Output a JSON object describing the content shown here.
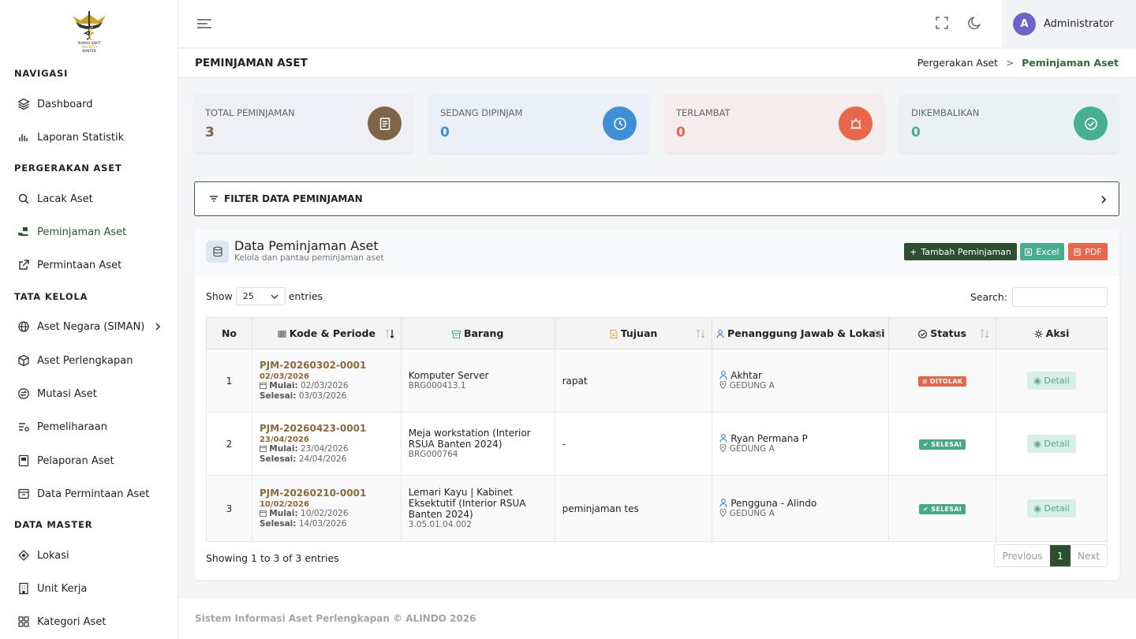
{
  "logo": {
    "text_line1": "RUMAH SAKIT",
    "text_line2": "AKHIRATA",
    "text_line3": "BANTEN"
  },
  "sidebar": {
    "sections": [
      {
        "title": "NAVIGASI",
        "items": [
          {
            "label": "Dashboard",
            "icon": "layers-icon"
          },
          {
            "label": "Laporan Statistik",
            "icon": "bar-chart-icon"
          }
        ]
      },
      {
        "title": "PERGERAKAN ASET",
        "items": [
          {
            "label": "Lacak Aset",
            "icon": "search-icon"
          },
          {
            "label": "Peminjaman Aset",
            "icon": "hand-box-icon",
            "active": true
          },
          {
            "label": "Permintaan Aset",
            "icon": "external-link-icon"
          }
        ]
      },
      {
        "title": "TATA KELOLA",
        "items": [
          {
            "label": "Aset Negara (SIMAN)",
            "icon": "globe-icon"
          },
          {
            "label": "Aset Perlengkapan",
            "icon": "package-icon"
          },
          {
            "label": "Mutasi Aset",
            "icon": "exchange-icon"
          },
          {
            "label": "Pemeliharaan",
            "icon": "list-settings-icon"
          },
          {
            "label": "Pelaporan Aset",
            "icon": "report-icon"
          },
          {
            "label": "Data Permintaan Aset",
            "icon": "calendar-box-icon"
          }
        ]
      },
      {
        "title": "DATA MASTER",
        "items": [
          {
            "label": "Lokasi",
            "icon": "location-icon"
          },
          {
            "label": "Unit Kerja",
            "icon": "building-icon"
          },
          {
            "label": "Kategori Aset",
            "icon": "grid-icon"
          }
        ]
      }
    ]
  },
  "topbar": {
    "user_initial": "A",
    "user_name": "Administrator"
  },
  "page": {
    "title": "PEMINJAMAN ASET",
    "breadcrumb": [
      "Pergerakan Aset",
      "Peminjaman Aset"
    ]
  },
  "stats": [
    {
      "label": "TOTAL PEMINJAMAN",
      "value": "3",
      "color": "#7d6548",
      "bg": "#eef0f6",
      "icon": "document-icon"
    },
    {
      "label": "SEDANG DIPINJAM",
      "value": "0",
      "color": "#3e8fd6",
      "bg": "#ebeff7",
      "icon": "clock-icon"
    },
    {
      "label": "TERLAMBAT",
      "value": "0",
      "color": "#e8674a",
      "bg": "#f5ecee",
      "icon": "alarm-icon"
    },
    {
      "label": "DIKEMBALIKAN",
      "value": "0",
      "color": "#47b08f",
      "bg": "#ebf0f2",
      "icon": "check-circle-icon"
    }
  ],
  "filter": {
    "label": "FILTER DATA PEMINJAMAN"
  },
  "panel": {
    "title": "Data Peminjaman Aset",
    "subtitle": "Kelola dan pantau peminjaman aset",
    "buttons": {
      "add": "Tambah Peminjaman",
      "excel": "Excel",
      "pdf": "PDF"
    },
    "show_label": "Show",
    "entries_label": "entries",
    "page_size": "25",
    "search_label": "Search:",
    "columns": [
      "No",
      "Kode & Periode",
      "Barang",
      "Tujuan",
      "Penanggung Jawab & Lokasi",
      "Status",
      "Aksi"
    ],
    "rows": [
      {
        "no": "1",
        "kode": "PJM-20260302-0001",
        "tanggal": "02/03/2026",
        "mulai_label": "Mulai:",
        "mulai": "02/03/2026",
        "selesai_label": "Selesai:",
        "selesai": "03/03/2026",
        "barang": "Komputer Server",
        "barang_kode": "BRG000413.1",
        "tujuan": "rapat",
        "pj": "Akhtar",
        "lokasi": "GEDUNG A",
        "status": "DITOLAK",
        "status_color": "#e2674b",
        "aksi": "Detail"
      },
      {
        "no": "2",
        "kode": "PJM-20260423-0001",
        "tanggal": "23/04/2026",
        "mulai_label": "Mulai:",
        "mulai": "23/04/2026",
        "selesai_label": "Selesai:",
        "selesai": "24/04/2026",
        "barang": "Meja workstation (Interior RSUA Banten 2024)",
        "barang_kode": "BRG000764",
        "tujuan": "-",
        "pj": "Ryan Permana P",
        "lokasi": "GEDUNG A",
        "status": "SELESAI",
        "status_color": "#47a98a",
        "aksi": "Detail"
      },
      {
        "no": "3",
        "kode": "PJM-20260210-0001",
        "tanggal": "10/02/2026",
        "mulai_label": "Mulai:",
        "mulai": "10/02/2026",
        "selesai_label": "Selesai:",
        "selesai": "14/03/2026",
        "barang": "Lemari Kayu | Kabinet Eksektutif (Interior RSUA Banten 2024)",
        "barang_kode": "3.05.01.04.002",
        "tujuan": "peminjaman tes",
        "pj": "Pengguna - Alindo",
        "lokasi": "GEDUNG A",
        "status": "SELESAI",
        "status_color": "#47a98a",
        "aksi": "Detail"
      }
    ],
    "info": "Showing 1 to 3 of 3 entries",
    "pager": {
      "prev": "Previous",
      "current": "1",
      "next": "Next"
    }
  },
  "footer": {
    "text": "Sistem Informasi Aset Perlengkapan © ALINDO 2026"
  }
}
